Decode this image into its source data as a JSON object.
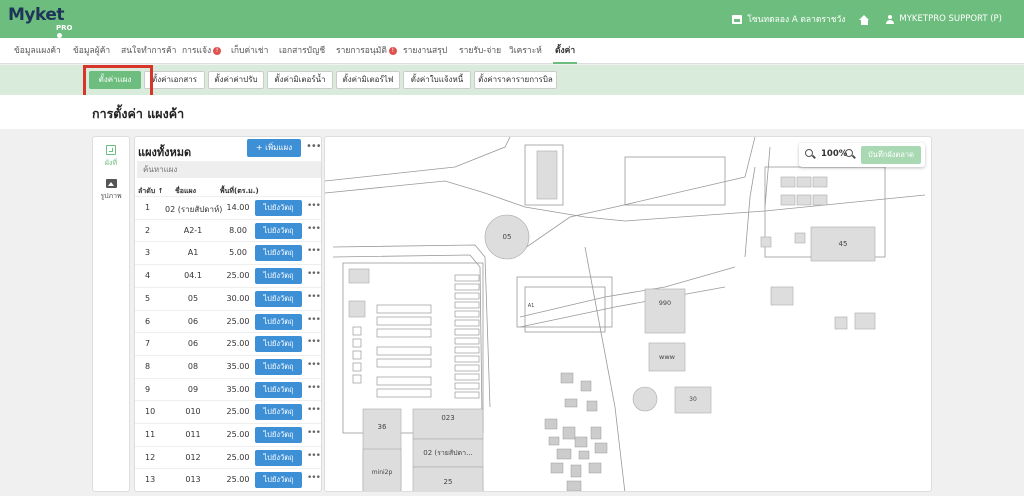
{
  "app": {
    "logo": "Myket",
    "logo_sub": "PRO",
    "market_name": "โซนทดลอง A ตลาดราชวัง",
    "user": "MYKETPRO SUPPORT (P)"
  },
  "main_nav": [
    {
      "label": "ข้อมูลแผงค้า",
      "badge": ""
    },
    {
      "label": "ข้อมูลผู้ค้า",
      "badge": ""
    },
    {
      "label": "สนใจทำการค้า",
      "badge": ""
    },
    {
      "label": "การแจ้ง",
      "badge": "!"
    },
    {
      "label": "เก็บค่าเช่า",
      "badge": ""
    },
    {
      "label": "เอกสารบัญชี",
      "badge": ""
    },
    {
      "label": "รายการอนุมัติ",
      "badge": "!"
    },
    {
      "label": "รายงานสรุป",
      "badge": ""
    },
    {
      "label": "รายรับ-จ่าย",
      "badge": ""
    },
    {
      "label": "วิเคราะห์",
      "badge": ""
    },
    {
      "label": "ตั้งค่า",
      "badge": ""
    }
  ],
  "sub_nav": [
    "ตั้งค่าแผง",
    "ตั้งค่าเอกสาร",
    "ตั้งค่าค่าปรับ",
    "ตั้งค่ามิเตอร์น้ำ",
    "ตั้งค่ามิเตอร์ไฟ",
    "ตั้งค่าใบแจ้งหนี้",
    "ตั้งค่าราคารายการบิล"
  ],
  "page_title": "การตั้งค่า แผงค้า",
  "side_tabs": [
    "ผังที่",
    "รูปภาพ"
  ],
  "list": {
    "title": "แผงทั้งหมด",
    "add_label": "+ เพิ่มแผง",
    "search_placeholder": "ค้นหาแผง",
    "columns": [
      "ลำดับ ↑",
      "ชื่อแผง",
      "พื้นที่(ตร.ม.)"
    ],
    "action_label": "ไปยังวัตถุ",
    "rows": [
      {
        "no": "1",
        "name": "02 (รายสัปดาห์)",
        "area": "14.00"
      },
      {
        "no": "2",
        "name": "A2-1",
        "area": "8.00"
      },
      {
        "no": "3",
        "name": "A1",
        "area": "5.00"
      },
      {
        "no": "4",
        "name": "04.1",
        "area": "25.00"
      },
      {
        "no": "5",
        "name": "05",
        "area": "30.00"
      },
      {
        "no": "6",
        "name": "06",
        "area": "25.00"
      },
      {
        "no": "7",
        "name": "06",
        "area": "25.00"
      },
      {
        "no": "8",
        "name": "08",
        "area": "35.00"
      },
      {
        "no": "9",
        "name": "09",
        "area": "35.00"
      },
      {
        "no": "10",
        "name": "010",
        "area": "25.00"
      },
      {
        "no": "11",
        "name": "011",
        "area": "25.00"
      },
      {
        "no": "12",
        "name": "012",
        "area": "25.00"
      },
      {
        "no": "13",
        "name": "013",
        "area": "25.00"
      }
    ]
  },
  "map": {
    "zoom": "100%",
    "save_label": "บันทึกผังตลาด",
    "labels": {
      "circle": "05",
      "stall_45": "45",
      "stall_990": "990",
      "stall_www": "www",
      "stall_30": "30",
      "stall_36": "36",
      "stall_023": "023",
      "stall_02": "02 (รายสัปดา...",
      "stall_mini": "mini2p",
      "stall_25": "25",
      "stall_a1": "A1"
    }
  }
}
